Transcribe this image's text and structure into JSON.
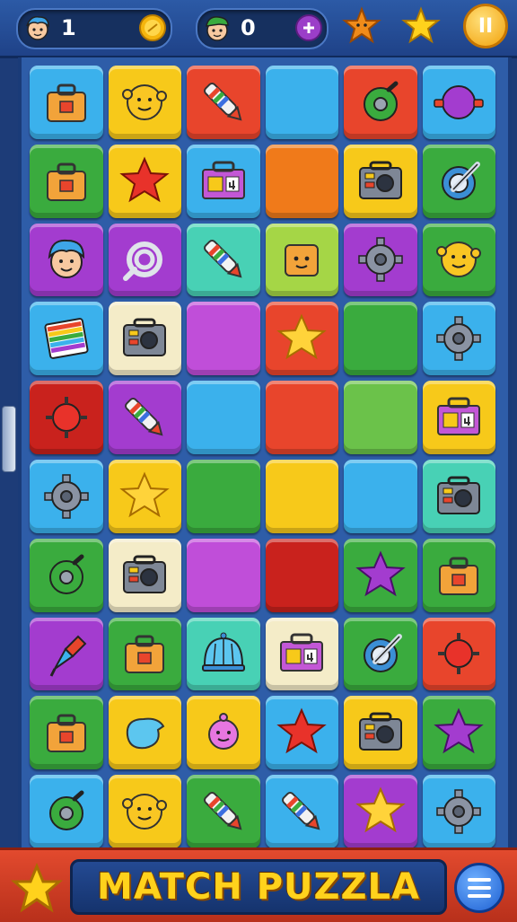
{
  "hud": {
    "player1": {
      "count": "1",
      "avatar_icon": "blue-hair-boy-avatar",
      "currency_icon": "gold-coin-icon"
    },
    "player2": {
      "count": "0",
      "avatar_icon": "green-cap-boy-avatar",
      "currency_icon": "purple-gem-icon"
    },
    "icons": [
      "orange-star-icon",
      "gold-star-icon"
    ],
    "pause_label": "II"
  },
  "colors": {
    "blue": "#3bb1ec",
    "yellow": "#f7c91a",
    "red": "#e8452c",
    "green": "#3aab3e",
    "purple": "#a33ccf",
    "orange": "#f07a1a",
    "teal": "#48d1b5",
    "lime": "#a5d646",
    "cream": "#f4ecc8",
    "darkred": "#c9221d",
    "lightgreen": "#6bc24a",
    "magenta": "#c04ed9"
  },
  "board": [
    [
      {
        "c": "blue",
        "i": "toolbox"
      },
      {
        "c": "yellow",
        "i": "blob-face"
      },
      {
        "c": "red",
        "i": "crayon"
      },
      {
        "c": "blue",
        "i": ""
      },
      {
        "c": "red",
        "i": "donut"
      },
      {
        "c": "blue",
        "i": "ball"
      }
    ],
    [
      {
        "c": "green",
        "i": "toolbox"
      },
      {
        "c": "yellow",
        "i": "star-red"
      },
      {
        "c": "blue",
        "i": "box-4"
      },
      {
        "c": "orange",
        "i": ""
      },
      {
        "c": "yellow",
        "i": "radio"
      },
      {
        "c": "green",
        "i": "ring"
      }
    ],
    [
      {
        "c": "purple",
        "i": "boy-face"
      },
      {
        "c": "purple",
        "i": "swirl"
      },
      {
        "c": "teal",
        "i": "crayon"
      },
      {
        "c": "lime",
        "i": "cube-face"
      },
      {
        "c": "purple",
        "i": "gear"
      },
      {
        "c": "green",
        "i": "blob-face"
      }
    ],
    [
      {
        "c": "blue",
        "i": "stripes"
      },
      {
        "c": "cream",
        "i": "radio"
      },
      {
        "c": "magenta",
        "i": ""
      },
      {
        "c": "red",
        "i": "star-yellow"
      },
      {
        "c": "green",
        "i": ""
      },
      {
        "c": "blue",
        "i": "gear"
      }
    ],
    [
      {
        "c": "darkred",
        "i": "mine"
      },
      {
        "c": "purple",
        "i": "crayon"
      },
      {
        "c": "blue",
        "i": ""
      },
      {
        "c": "red",
        "i": ""
      },
      {
        "c": "lightgreen",
        "i": ""
      },
      {
        "c": "yellow",
        "i": "box-4"
      }
    ],
    [
      {
        "c": "blue",
        "i": "gear"
      },
      {
        "c": "yellow",
        "i": "star-yellow"
      },
      {
        "c": "green",
        "i": ""
      },
      {
        "c": "yellow",
        "i": ""
      },
      {
        "c": "blue",
        "i": ""
      },
      {
        "c": "teal",
        "i": "radio"
      }
    ],
    [
      {
        "c": "green",
        "i": "donut"
      },
      {
        "c": "cream",
        "i": "radio"
      },
      {
        "c": "magenta",
        "i": ""
      },
      {
        "c": "darkred",
        "i": ""
      },
      {
        "c": "green",
        "i": "star-purple"
      },
      {
        "c": "green",
        "i": "toolbox"
      }
    ],
    [
      {
        "c": "purple",
        "i": "brush"
      },
      {
        "c": "green",
        "i": "toolbox"
      },
      {
        "c": "teal",
        "i": "dome"
      },
      {
        "c": "cream",
        "i": "box-4"
      },
      {
        "c": "green",
        "i": "ring"
      },
      {
        "c": "red",
        "i": "mine"
      }
    ],
    [
      {
        "c": "green",
        "i": "toolbox"
      },
      {
        "c": "yellow",
        "i": "blob-blue"
      },
      {
        "c": "yellow",
        "i": "blob-pink"
      },
      {
        "c": "blue",
        "i": "star-red"
      },
      {
        "c": "yellow",
        "i": "radio"
      },
      {
        "c": "green",
        "i": "star-purple"
      }
    ],
    [
      {
        "c": "blue",
        "i": "donut"
      },
      {
        "c": "yellow",
        "i": "blob-face"
      },
      {
        "c": "green",
        "i": "crayon"
      },
      {
        "c": "blue",
        "i": "crayon"
      },
      {
        "c": "purple",
        "i": "star-yellow"
      },
      {
        "c": "blue",
        "i": "gear"
      }
    ]
  ],
  "footer": {
    "title": "MATCH PUZZLA",
    "star_icon": "gold-star-icon",
    "menu_icon": "hamburger-menu-icon"
  }
}
